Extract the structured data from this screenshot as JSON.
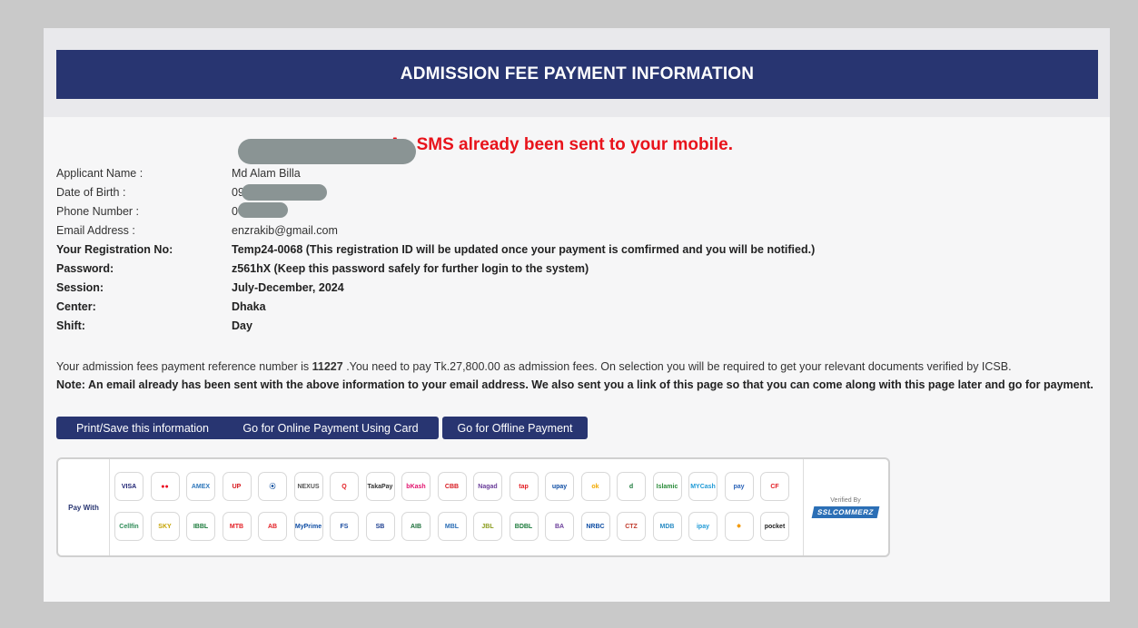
{
  "title": "ADMISSION FEE PAYMENT INFORMATION",
  "sms_notice": "An SMS already been sent to your mobile.",
  "fields": [
    {
      "label": "Applicant Name :",
      "value": "Md Alam Billa",
      "bold": false
    },
    {
      "label": "Date of Birth :",
      "value": "09",
      "bold": false
    },
    {
      "label": "Phone Number :",
      "value": "0         991",
      "bold": false
    },
    {
      "label": "Email Address :",
      "value": "enzrakib@gmail.com",
      "bold": false
    },
    {
      "label": "Your Registration No:",
      "value": "Temp24-0068  (This registration ID will be updated once your payment is comfirmed and you will be notified.)",
      "bold": true
    },
    {
      "label": "Password:",
      "value": "z561hX  (Keep this password safely for further login to the system)",
      "bold": true
    },
    {
      "label": "Session:",
      "value": "July-December, 2024",
      "bold": true
    },
    {
      "label": "Center:",
      "value": "Dhaka",
      "bold": true
    },
    {
      "label": "Shift:",
      "value": "Day",
      "bold": true
    }
  ],
  "payment_info": {
    "prefix": "Your admission fees payment reference number is ",
    "reference": "11227",
    "suffix": " .You need to pay Tk.27,800.00  as admission fees. On selection you will be required to get your relevant documents verified by ICSB."
  },
  "email_note": "Note: An email already has been sent with the above information to your email address. We also sent you a link of this page so that you can come along with this page later and go for payment.",
  "buttons": {
    "print": "Print/Save this information",
    "online": "Go for Online Payment Using Card",
    "offline": "Go for Offline Payment"
  },
  "payment_gateway": {
    "pay_with": "Pay With",
    "verified_by": "Verified By",
    "provider": "SSLCOMMERZ",
    "row1": [
      {
        "name": "visa",
        "text": "VISA",
        "color": "#1a1f71"
      },
      {
        "name": "mastercard",
        "text": "●●",
        "color": "#eb001b"
      },
      {
        "name": "amex",
        "text": "AMEX",
        "color": "#2e77bb"
      },
      {
        "name": "unionpay",
        "text": "UP",
        "color": "#d7141a"
      },
      {
        "name": "diners",
        "text": "⦿",
        "color": "#0a4a9b"
      },
      {
        "name": "dbbl-nexus",
        "text": "NEXUS",
        "color": "#555"
      },
      {
        "name": "qcash",
        "text": "Q",
        "color": "#e31e24"
      },
      {
        "name": "takapay",
        "text": "TakaPay",
        "color": "#333"
      },
      {
        "name": "bkash",
        "text": "bKash",
        "color": "#e2136e"
      },
      {
        "name": "city-bank",
        "text": "CBB",
        "color": "#d71920"
      },
      {
        "name": "nagad",
        "text": "Nagad",
        "color": "#6a3d9a"
      },
      {
        "name": "tap",
        "text": "tap",
        "color": "#e31e24"
      },
      {
        "name": "upay",
        "text": "upay",
        "color": "#0e4da4"
      },
      {
        "name": "ok-wallet",
        "text": "ok",
        "color": "#f2a900"
      },
      {
        "name": "dmoney",
        "text": "d",
        "color": "#1b7a3b"
      },
      {
        "name": "islamic-wallet",
        "text": "Islamic",
        "color": "#2a8c3a"
      },
      {
        "name": "mycash",
        "text": "MYCash",
        "color": "#1f9ad6"
      },
      {
        "name": "meghna-pay",
        "text": "pay",
        "color": "#2a63b8"
      },
      {
        "name": "islami-cellfin",
        "text": "CF",
        "color": "#e31e24"
      }
    ],
    "row2": [
      {
        "name": "cellfin",
        "text": "Cellfin",
        "color": "#2e8b57"
      },
      {
        "name": "ebl-sky",
        "text": "SKY",
        "color": "#c5a300"
      },
      {
        "name": "islami-bank",
        "text": "IBBL",
        "color": "#1b7a3b"
      },
      {
        "name": "mtb",
        "text": "MTB",
        "color": "#e31e24"
      },
      {
        "name": "ab-bank",
        "text": "AB",
        "color": "#e31e24"
      },
      {
        "name": "myprime",
        "text": "MyPrime",
        "color": "#0e4da4"
      },
      {
        "name": "fsibl",
        "text": "FS",
        "color": "#1a4ca0"
      },
      {
        "name": "sbl",
        "text": "SB",
        "color": "#1a3c8f"
      },
      {
        "name": "al-arafah",
        "text": "AIB",
        "color": "#1b6f3a"
      },
      {
        "name": "mercantile",
        "text": "MBL",
        "color": "#2a6db5"
      },
      {
        "name": "jamuna",
        "text": "JBL",
        "color": "#8a9b1c"
      },
      {
        "name": "bdbl",
        "text": "BDBL",
        "color": "#1b7a3b"
      },
      {
        "name": "bank-asia",
        "text": "BA",
        "color": "#6a3d9a"
      },
      {
        "name": "nrbc",
        "text": "NRBC",
        "color": "#0e4da4"
      },
      {
        "name": "citizens-bank",
        "text": "CTZ",
        "color": "#c0392b"
      },
      {
        "name": "midland",
        "text": "MDB",
        "color": "#2a8cc4"
      },
      {
        "name": "ipay",
        "text": "ipay",
        "color": "#1f9ad6"
      },
      {
        "name": "dreamers",
        "text": "✸",
        "color": "#f39c12"
      },
      {
        "name": "pocket",
        "text": "pocket",
        "color": "#222"
      }
    ]
  }
}
